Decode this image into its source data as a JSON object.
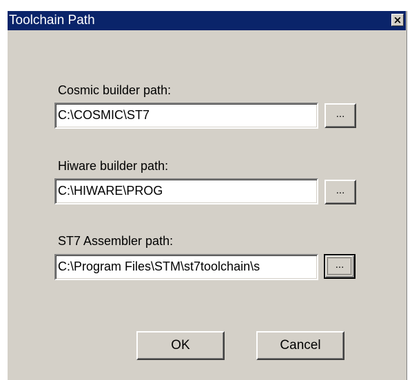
{
  "window": {
    "title": "Toolchain Path",
    "close_glyph": "×",
    "close_icon": "close-icon"
  },
  "fields": {
    "cosmic": {
      "label": "Cosmic builder path:",
      "value": "C:\\COSMIC\\ST7",
      "browse_label": "..."
    },
    "hiware": {
      "label": "Hiware builder path:",
      "value": "C:\\HIWARE\\PROG",
      "browse_label": "..."
    },
    "st7asm": {
      "label": "ST7 Assembler path:",
      "value": "C:\\Program Files\\STM\\st7toolchain\\s",
      "browse_label": "..."
    }
  },
  "buttons": {
    "ok_label": "OK",
    "cancel_label": "Cancel"
  },
  "colors": {
    "titlebar": "#0a246a",
    "face": "#d4d0c8"
  }
}
